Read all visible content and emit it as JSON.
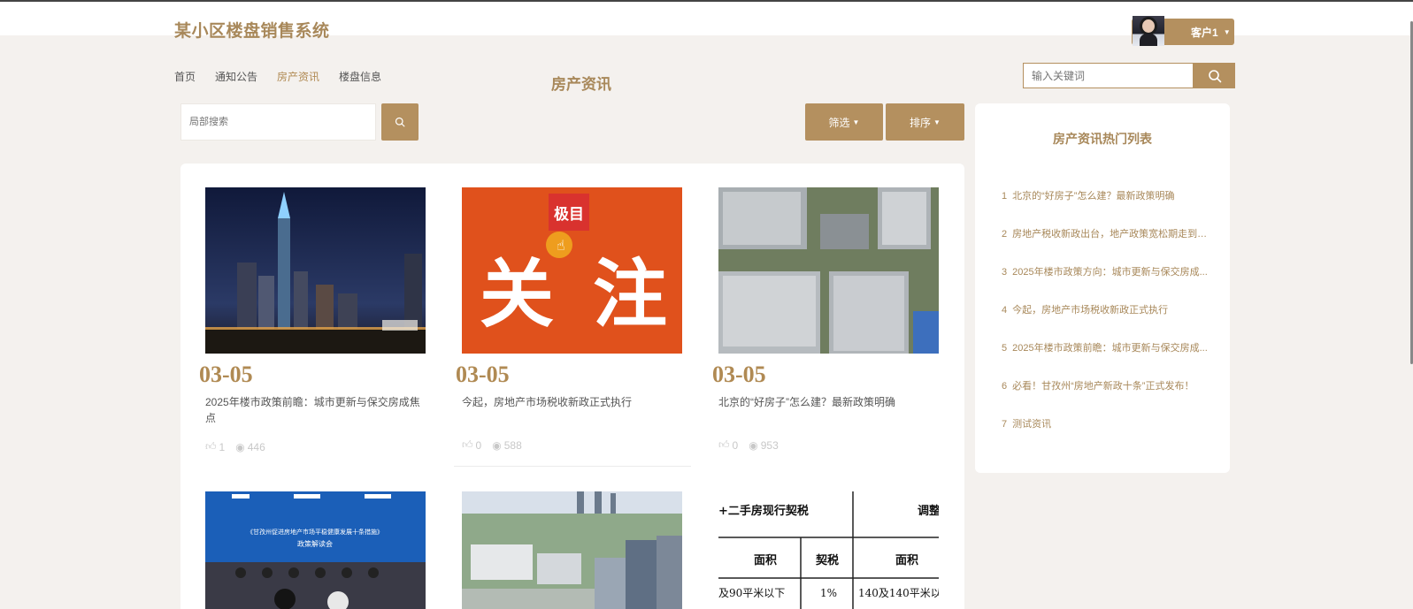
{
  "header": {
    "site_title": "某小区楼盘销售系统",
    "user_name": "客户1"
  },
  "nav": {
    "items": [
      "首页",
      "通知公告",
      "房产资讯",
      "楼盘信息"
    ],
    "active_index": 2
  },
  "page_heading": "房产资讯",
  "top_search": {
    "placeholder": "输入关键词"
  },
  "toolbar": {
    "local_search_placeholder": "局部搜索",
    "filter_label": "筛选",
    "sort_label": "排序"
  },
  "cards": [
    {
      "date": "03-05",
      "title": "2025年楼市政策前瞻：城市更新与保交房成焦点",
      "likes": "1",
      "views": "446",
      "image": "city-night-skyline"
    },
    {
      "date": "03-05",
      "title": "今起，房地产市场税收新政正式执行",
      "likes": "0",
      "views": "588",
      "image": "orange-focus-banner"
    },
    {
      "date": "03-05",
      "title": "北京的“好房子”怎么建？最新政策明确",
      "likes": "0",
      "views": "953",
      "image": "residential-towers-aerial"
    },
    {
      "image": "policy-meeting-photo"
    },
    {
      "image": "city-aerial-view"
    },
    {
      "image": "tax-table"
    }
  ],
  "card_images_text": {
    "orange_logo": "极目",
    "orange_big_left": "关",
    "orange_big_right": "注",
    "meeting_banner_line1": "《甘孜州促进房地产市场平稳健康发展十条措施》",
    "meeting_banner_line2": "政策解读会",
    "table_header_left": "+二手房现行契税",
    "table_header_right": "调整",
    "table_col_area": "面积",
    "table_col_tax": "契税",
    "table_col_area2": "面积",
    "table_row1_area": "及90平米以下",
    "table_row1_tax": "1%",
    "table_row1_area2": "140及140平米以"
  },
  "sidebar": {
    "title": "房产资讯热门列表",
    "items": [
      {
        "num": "1",
        "text": "北京的“好房子”怎么建？最新政策明确"
      },
      {
        "num": "2",
        "text": "房地产税收新政出台，地产政策宽松期走到哪..."
      },
      {
        "num": "3",
        "text": "2025年楼市政策方向：城市更新与保交房成..."
      },
      {
        "num": "4",
        "text": "今起，房地产市场税收新政正式执行"
      },
      {
        "num": "5",
        "text": "2025年楼市政策前瞻：城市更新与保交房成..."
      },
      {
        "num": "6",
        "text": "必看！甘孜州“房地产新政十条”正式发布！"
      },
      {
        "num": "7",
        "text": "测试资讯"
      }
    ]
  },
  "colors": {
    "accent": "#b4905f",
    "title": "#a8885a",
    "background": "#f4f1ee"
  }
}
